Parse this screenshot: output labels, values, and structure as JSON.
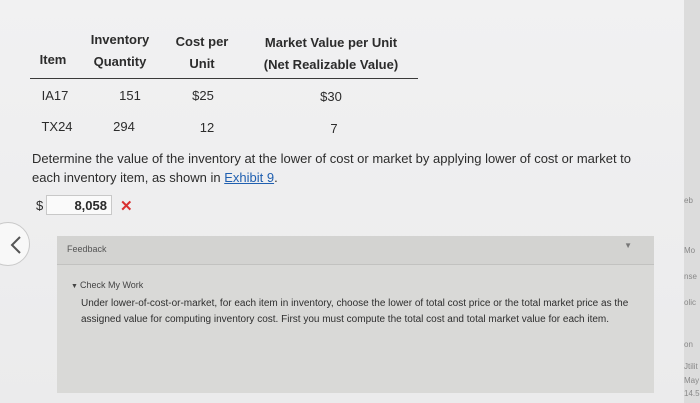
{
  "table": {
    "headers": {
      "item": "Item",
      "inv_qty_1": "Inventory",
      "inv_qty_2": "Quantity",
      "cost_1": "Cost per",
      "cost_2": "Unit",
      "mv_1": "Market Value per Unit",
      "mv_2": "(Net Realizable Value)"
    },
    "rows": [
      {
        "item": "IA17",
        "qty": "151",
        "cost": "$25",
        "market": "$30"
      },
      {
        "item": "TX24",
        "qty": "294",
        "cost": "12",
        "market": "7"
      }
    ]
  },
  "question": {
    "text": "Determine the value of the inventory at the lower of cost or market by applying lower of cost or market to each inventory item, as shown in ",
    "link": "Exhibit 9",
    "end": "."
  },
  "answer": {
    "currency": "$",
    "value": "8,058",
    "status_mark": "✕",
    "status_color": "#d93030"
  },
  "feedback": {
    "title": "Feedback",
    "check_label": "Check My Work",
    "body": "Under lower-of-cost-or-market, for each item in inventory, choose the lower of total cost price or the total market price as the assigned value for computing inventory cost. First you must compute the total cost and total market value for each item."
  },
  "side_strip": [
    "eb",
    "Mo",
    "nse",
    "olic",
    "on",
    "Jtilit",
    "May 1",
    "14.5"
  ],
  "icons": {
    "back": "chevron-left-icon",
    "collapse": "caret-down-icon"
  }
}
